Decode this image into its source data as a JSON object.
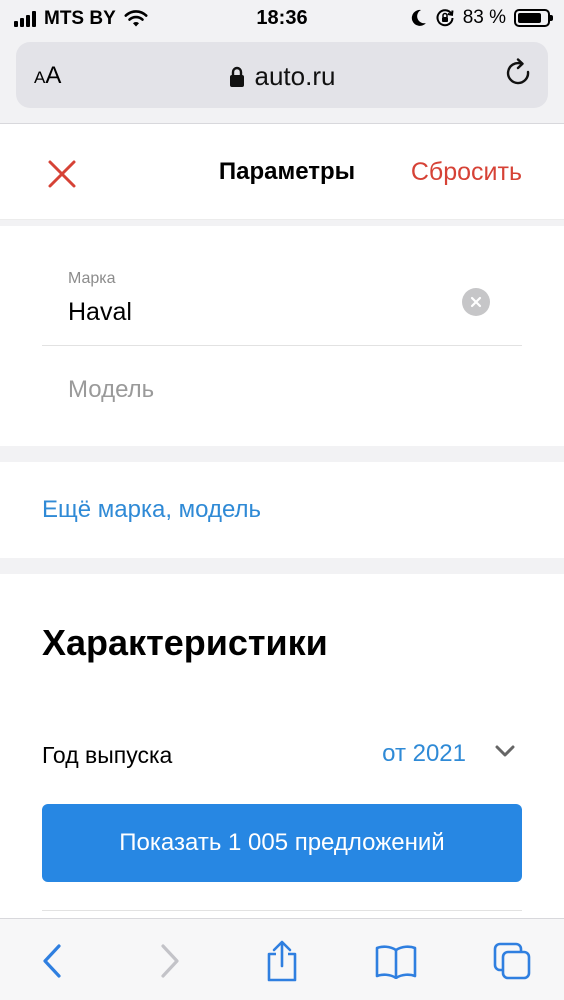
{
  "status_bar": {
    "carrier": "MTS BY",
    "time": "18:36",
    "battery_percent": "83 %",
    "battery_level": 0.83
  },
  "browser": {
    "text_size_label_small": "A",
    "text_size_label_large": "A",
    "url": "auto.ru"
  },
  "header": {
    "title": "Параметры",
    "reset_label": "Сбросить"
  },
  "form": {
    "brand_label": "Марка",
    "brand_value": "Haval",
    "model_placeholder": "Модель"
  },
  "more_link": "Ещё марка, модель",
  "characteristics": {
    "title": "Характеристики",
    "year_label": "Год выпуска",
    "year_value": "от 2021"
  },
  "show_button": "Показать 1 005 предложений",
  "colors": {
    "accent_blue": "#2787e3",
    "link_blue": "#2f8ad6",
    "reset_red": "#d64236",
    "close_red": "#d64236"
  },
  "icons": {
    "signal": "cellular-signal-icon",
    "wifi": "wifi-icon",
    "moon": "do-not-disturb-icon",
    "rotation_lock": "rotation-lock-icon",
    "lock": "lock-icon",
    "reload": "reload-icon",
    "close": "close-icon",
    "clear": "clear-field-icon",
    "chevron": "chevron-down-icon",
    "back": "back-icon",
    "forward": "forward-icon",
    "share": "share-icon",
    "bookmarks": "bookmarks-icon",
    "tabs": "tabs-icon"
  }
}
